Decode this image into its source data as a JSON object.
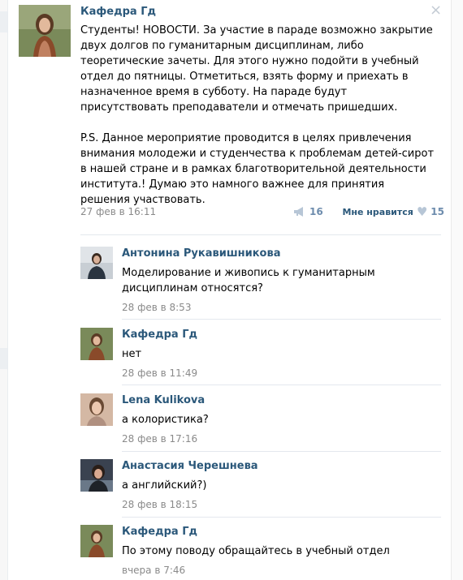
{
  "post": {
    "author": "Кафедра Гд",
    "lines": [
      "Студенты! НОВОСТИ. За участие в параде возможно закрытие",
      "двух долгов по гуманитарным дисциплинам, либо",
      "теоретические зачеты. Для этого нужно подойти в учебный",
      "отдел до пятницы. Отметиться, взять форму и приехать в",
      "назначенное время в субботу. На параде будут",
      "присутствовать преподаватели и отмечать пришедших."
    ],
    "ps_lines": [
      "P.S. Данное мероприятие проводится в целях привлечения",
      "внимания молодежи и студенчества к проблемам детей-сирот",
      "в нашей стране и в рамках благотворительной деятельности",
      "института.! Думаю это намного важнее для принятия",
      "решения участвовать."
    ],
    "date": "27 фев в 16:11",
    "share_count": "16",
    "like_label": "Мне нравится",
    "like_count": "15",
    "close_glyph": "×"
  },
  "comments": [
    {
      "author": "Антонина Рукавишникова",
      "lines": [
        "Моделирование и живопись к гуманитарным",
        "дисциплинам относятся?"
      ],
      "date": "28 фев в 8:53"
    },
    {
      "author": "Кафедра Гд",
      "lines": [
        "нет"
      ],
      "date": "28 фев в 11:49"
    },
    {
      "author": "Lena Kulikova",
      "lines": [
        "а колористика?"
      ],
      "date": "28 фев в 17:16"
    },
    {
      "author": "Анастасия Черешнева",
      "lines": [
        "а английский?)"
      ],
      "date": "28 фев в 18:15"
    },
    {
      "author": "Кафедра Гд",
      "lines": [
        "По этому поводу обращайтесь в учебный отдел"
      ],
      "date": "вчера в 7:46"
    }
  ],
  "colors": {
    "link": "#2b587a",
    "muted": "#8a8a8a",
    "accent": "#6d8cad"
  },
  "icons": {
    "share": "megaphone-icon",
    "like": "heart-icon",
    "close": "close-icon"
  }
}
